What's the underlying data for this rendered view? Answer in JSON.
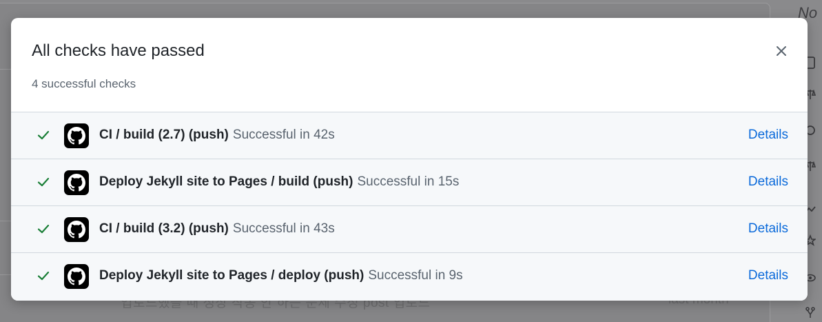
{
  "modal": {
    "title": "All checks have passed",
    "subtitle": "4 successful checks",
    "close_icon": "close-icon"
  },
  "checks": [
    {
      "name": "CI / build (2.7) (push)",
      "status": "Successful in 42s",
      "details": "Details",
      "icon": "github-icon",
      "state_icon": "check-icon"
    },
    {
      "name": "Deploy Jekyll site to Pages / build (push)",
      "status": "Successful in 15s",
      "details": "Details",
      "icon": "github-icon",
      "state_icon": "check-icon"
    },
    {
      "name": "CI / build (3.2) (push)",
      "status": "Successful in 43s",
      "details": "Details",
      "icon": "github-icon",
      "state_icon": "check-icon"
    },
    {
      "name": "Deploy Jekyll site to Pages / deploy (push)",
      "status": "Successful in 9s",
      "details": "Details",
      "icon": "github-icon",
      "state_icon": "check-icon"
    }
  ],
  "background": {
    "side_text": "No",
    "footer_text": "업로드했을 때 정상 작동 안 하는 문제 수정 post 업로드",
    "footer_time": "last month"
  },
  "colors": {
    "success": "#1a7f37",
    "link": "#0969da",
    "overlay": "#7f7f81"
  }
}
